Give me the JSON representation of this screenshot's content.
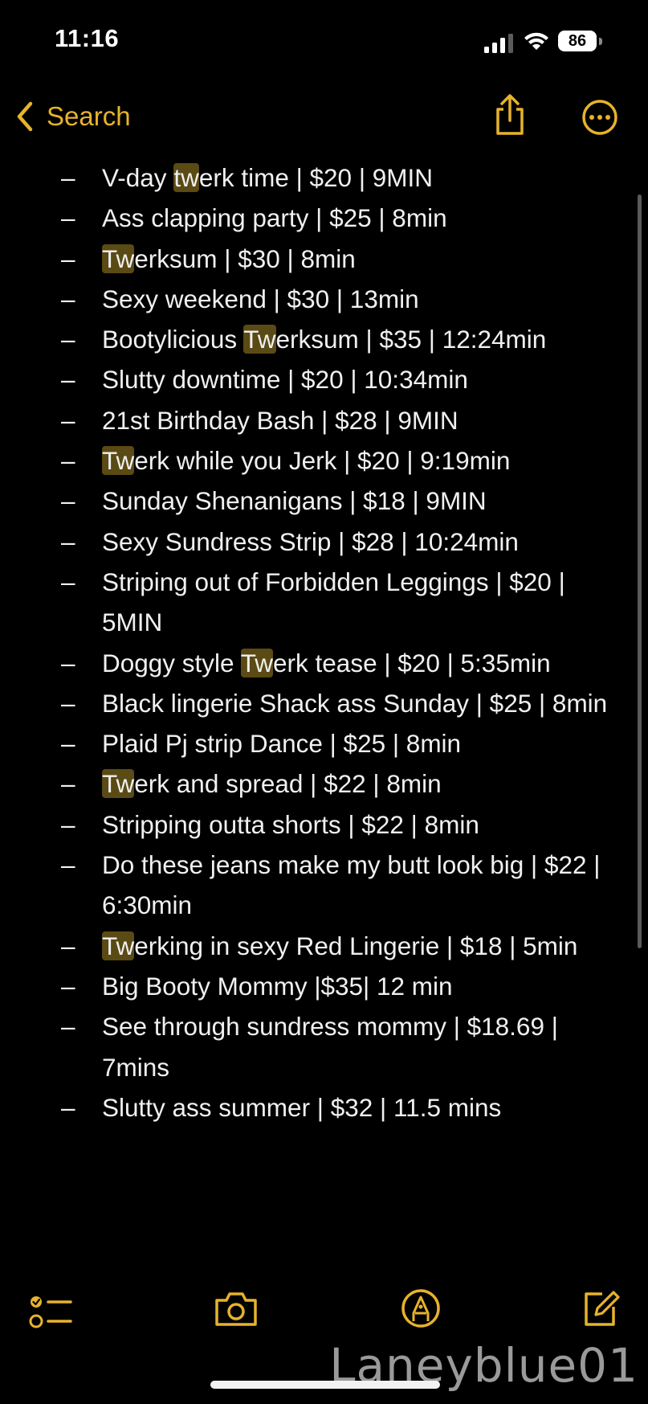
{
  "status_bar": {
    "time": "11:16",
    "battery": "86",
    "icons": [
      "cellular-signal-icon",
      "wifi-icon",
      "battery-icon"
    ]
  },
  "nav": {
    "back_label": "Search",
    "back_icon": "chevron-left-icon",
    "share_icon": "share-icon",
    "more_icon": "ellipsis-circle-icon",
    "accent_color": "#e7b32c"
  },
  "search": {
    "query": "Tw",
    "highlight_color": "#5a4a14"
  },
  "note": {
    "items": [
      {
        "pre": "V-day ",
        "hl": "tw",
        "post": "erk time | $20 | 9MIN"
      },
      {
        "pre": "Ass clapping party | $25 | 8min",
        "hl": "",
        "post": ""
      },
      {
        "pre": "",
        "hl": "Tw",
        "post": "erksum | $30 | 8min"
      },
      {
        "pre": "Sexy weekend | $30 | 13min",
        "hl": "",
        "post": ""
      },
      {
        "pre": "Bootylicious ",
        "hl": "Tw",
        "post": "erksum | $35 | 12:24min"
      },
      {
        "pre": "Slutty downtime | $20 | 10:34min",
        "hl": "",
        "post": ""
      },
      {
        "pre": "21st Birthday Bash | $28 | 9MIN",
        "hl": "",
        "post": ""
      },
      {
        "pre": "",
        "hl": "Tw",
        "post": "erk while you Jerk | $20 | 9:19min"
      },
      {
        "pre": "Sunday Shenanigans | $18 | 9MIN",
        "hl": "",
        "post": ""
      },
      {
        "pre": "Sexy Sundress Strip | $28 | 10:24min",
        "hl": "",
        "post": ""
      },
      {
        "pre": "Striping out of Forbidden Leggings | $20 | 5MIN",
        "hl": "",
        "post": ""
      },
      {
        "pre": "Doggy style ",
        "hl": "Tw",
        "post": "erk tease | $20 | 5:35min"
      },
      {
        "pre": "Black lingerie Shack ass Sunday | $25 | 8min",
        "hl": "",
        "post": ""
      },
      {
        "pre": "Plaid Pj strip Dance | $25 | 8min",
        "hl": "",
        "post": ""
      },
      {
        "pre": "",
        "hl": "Tw",
        "post": "erk and spread | $22 | 8min"
      },
      {
        "pre": "Stripping outta shorts | $22 | 8min",
        "hl": "",
        "post": ""
      },
      {
        "pre": "Do these jeans make my butt look big | $22 | 6:30min",
        "hl": "",
        "post": ""
      },
      {
        "pre": "",
        "hl": "Tw",
        "post": "erking in sexy Red Lingerie | $18 | 5min"
      },
      {
        "pre": "Big Booty Mommy |$35| 12 min",
        "hl": "",
        "post": ""
      },
      {
        "pre": "See through sundress mommy | $18.69 | 7mins",
        "hl": "",
        "post": ""
      },
      {
        "pre": "Slutty ass summer | $32 | 11.5 mins",
        "hl": "",
        "post": ""
      }
    ]
  },
  "toolbar": {
    "icons": [
      "checklist-icon",
      "camera-icon",
      "markup-pen-icon",
      "compose-icon"
    ]
  },
  "watermark": "Laneyblue01"
}
